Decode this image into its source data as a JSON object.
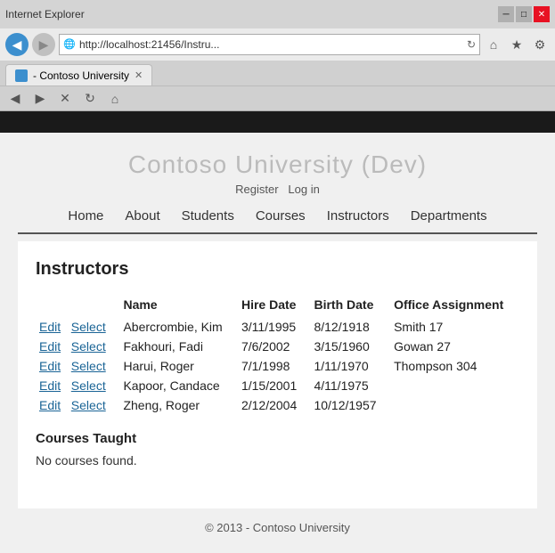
{
  "browser": {
    "title": "- Contoso University",
    "address": "http://localhost:21456/Instru...",
    "back_icon": "◀",
    "forward_icon": "▶",
    "minimize_label": "─",
    "maximize_label": "□",
    "close_label": "✕",
    "home_icon": "⌂",
    "star_icon": "★",
    "gear_icon": "⚙"
  },
  "site": {
    "title": "Contoso University (Dev)",
    "register_link": "Register",
    "login_link": "Log in",
    "nav": {
      "home": "Home",
      "about": "About",
      "students": "Students",
      "courses": "Courses",
      "instructors": "Instructors",
      "departments": "Departments"
    }
  },
  "page": {
    "heading": "Instructors",
    "table": {
      "columns": [
        "Name",
        "Hire Date",
        "Birth Date",
        "Office Assignment"
      ],
      "rows": [
        {
          "name": "Abercrombie, Kim",
          "hire_date": "3/11/1995",
          "birth_date": "8/12/1918",
          "office": "Smith 17"
        },
        {
          "name": "Fakhouri, Fadi",
          "hire_date": "7/6/2002",
          "birth_date": "3/15/1960",
          "office": "Gowan 27"
        },
        {
          "name": "Harui, Roger",
          "hire_date": "7/1/1998",
          "birth_date": "1/11/1970",
          "office": "Thompson 304"
        },
        {
          "name": "Kapoor, Candace",
          "hire_date": "1/15/2001",
          "birth_date": "4/11/1975",
          "office": ""
        },
        {
          "name": "Zheng, Roger",
          "hire_date": "2/12/2004",
          "birth_date": "10/12/1957",
          "office": ""
        }
      ],
      "edit_label": "Edit",
      "select_label": "Select"
    },
    "courses_heading": "Courses Taught",
    "no_courses": "No courses found."
  },
  "footer": {
    "text": "© 2013 - Contoso University"
  }
}
